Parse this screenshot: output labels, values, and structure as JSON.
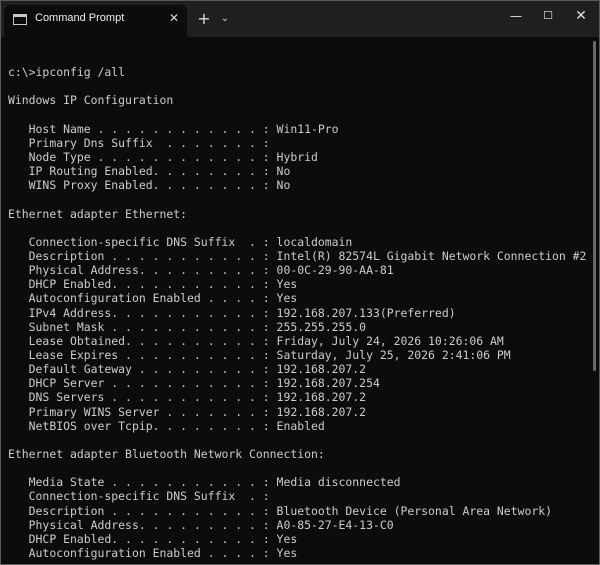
{
  "window": {
    "tab_title": "Command Prompt",
    "tab_close": "✕",
    "new_tab": "+",
    "dropdown": "⌄",
    "minimize": "—",
    "maximize": "☐",
    "close": "✕",
    "icons": [
      "terminal-icon",
      "close-icon",
      "plus-icon",
      "chevron-down-icon",
      "minimize-icon",
      "maximize-icon",
      "close-icon"
    ]
  },
  "console": {
    "lines": [
      "",
      "c:\\>ipconfig /all",
      "",
      "Windows IP Configuration",
      "",
      "   Host Name . . . . . . . . . . . . : Win11-Pro",
      "   Primary Dns Suffix  . . . . . . . :",
      "   Node Type . . . . . . . . . . . . : Hybrid",
      "   IP Routing Enabled. . . . . . . . : No",
      "   WINS Proxy Enabled. . . . . . . . : No",
      "",
      "Ethernet adapter Ethernet:",
      "",
      "   Connection-specific DNS Suffix  . : localdomain",
      "   Description . . . . . . . . . . . : Intel(R) 82574L Gigabit Network Connection #2",
      "   Physical Address. . . . . . . . . : 00-0C-29-90-AA-81",
      "   DHCP Enabled. . . . . . . . . . . : Yes",
      "   Autoconfiguration Enabled . . . . : Yes",
      "   IPv4 Address. . . . . . . . . . . : 192.168.207.133(Preferred)",
      "   Subnet Mask . . . . . . . . . . . : 255.255.255.0",
      "   Lease Obtained. . . . . . . . . . : Friday, July 24, 2026 10:26:06 AM",
      "   Lease Expires . . . . . . . . . . : Saturday, July 25, 2026 2:41:06 PM",
      "   Default Gateway . . . . . . . . . : 192.168.207.2",
      "   DHCP Server . . . . . . . . . . . : 192.168.207.254",
      "   DNS Servers . . . . . . . . . . . : 192.168.207.2",
      "   Primary WINS Server . . . . . . . : 192.168.207.2",
      "   NetBIOS over Tcpip. . . . . . . . : Enabled",
      "",
      "Ethernet adapter Bluetooth Network Connection:",
      "",
      "   Media State . . . . . . . . . . . : Media disconnected",
      "   Connection-specific DNS Suffix  . :",
      "   Description . . . . . . . . . . . : Bluetooth Device (Personal Area Network)",
      "   Physical Address. . . . . . . . . : A0-85-27-E4-13-C0",
      "   DHCP Enabled. . . . . . . . . . . : Yes",
      "   Autoconfiguration Enabled . . . . : Yes"
    ]
  },
  "colors": {
    "titlebar": "#1f1f1f",
    "console_bg": "#0c0c0c",
    "console_text": "#cccccc"
  }
}
